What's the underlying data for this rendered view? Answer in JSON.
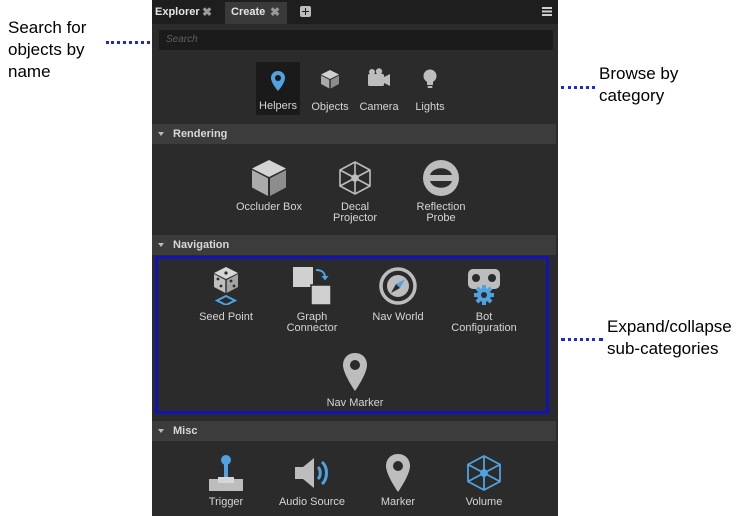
{
  "callouts": {
    "search": [
      "Search for",
      "objects by",
      "name"
    ],
    "browse": [
      "Browse by",
      "category"
    ],
    "expand": [
      "Expand/collapse",
      "sub-categories"
    ]
  },
  "tabs": {
    "explorer": "Explorer",
    "create": "Create",
    "close_glyph": "✖"
  },
  "search": {
    "placeholder": "Search"
  },
  "categories": [
    {
      "label": "Helpers",
      "icon": "map-pin-icon",
      "selected": true
    },
    {
      "label": "Objects",
      "icon": "cube-icon",
      "selected": false
    },
    {
      "label": "Camera",
      "icon": "camera-icon",
      "selected": false
    },
    {
      "label": "Lights",
      "icon": "lightbulb-icon",
      "selected": false
    }
  ],
  "sections": {
    "rendering": {
      "title": "Rendering",
      "items": [
        {
          "label1": "Occluder Box",
          "label2": "",
          "icon": "cube-icon"
        },
        {
          "label1": "Decal",
          "label2": "Projector",
          "icon": "wireframe-cube-icon"
        },
        {
          "label1": "Reflection",
          "label2": "Probe",
          "icon": "reflection-probe-icon"
        }
      ]
    },
    "navigation": {
      "title": "Navigation",
      "items": [
        {
          "label1": "Seed Point",
          "label2": "",
          "icon": "dice-icon"
        },
        {
          "label1": "Graph",
          "label2": "Connector",
          "icon": "graph-connector-icon"
        },
        {
          "label1": "Nav World",
          "label2": "",
          "icon": "compass-icon"
        },
        {
          "label1": "Bot",
          "label2": "Configuration",
          "icon": "bot-gear-icon"
        },
        {
          "label1": "Nav Marker",
          "label2": "",
          "icon": "map-pin-icon"
        }
      ]
    },
    "misc": {
      "title": "Misc",
      "items": [
        {
          "label1": "Trigger",
          "label2": "",
          "icon": "joystick-icon"
        },
        {
          "label1": "Audio Source",
          "label2": "",
          "icon": "speaker-icon"
        },
        {
          "label1": "Marker",
          "label2": "",
          "icon": "map-pin-icon"
        },
        {
          "label1": "Volume",
          "label2": "",
          "icon": "wireframe-cube-icon"
        }
      ]
    }
  },
  "colors": {
    "accent": "#4fa3e0",
    "icon": "#bdbdbd",
    "highlight": "#1212b8",
    "callout_dots": "#1a2bd6"
  }
}
